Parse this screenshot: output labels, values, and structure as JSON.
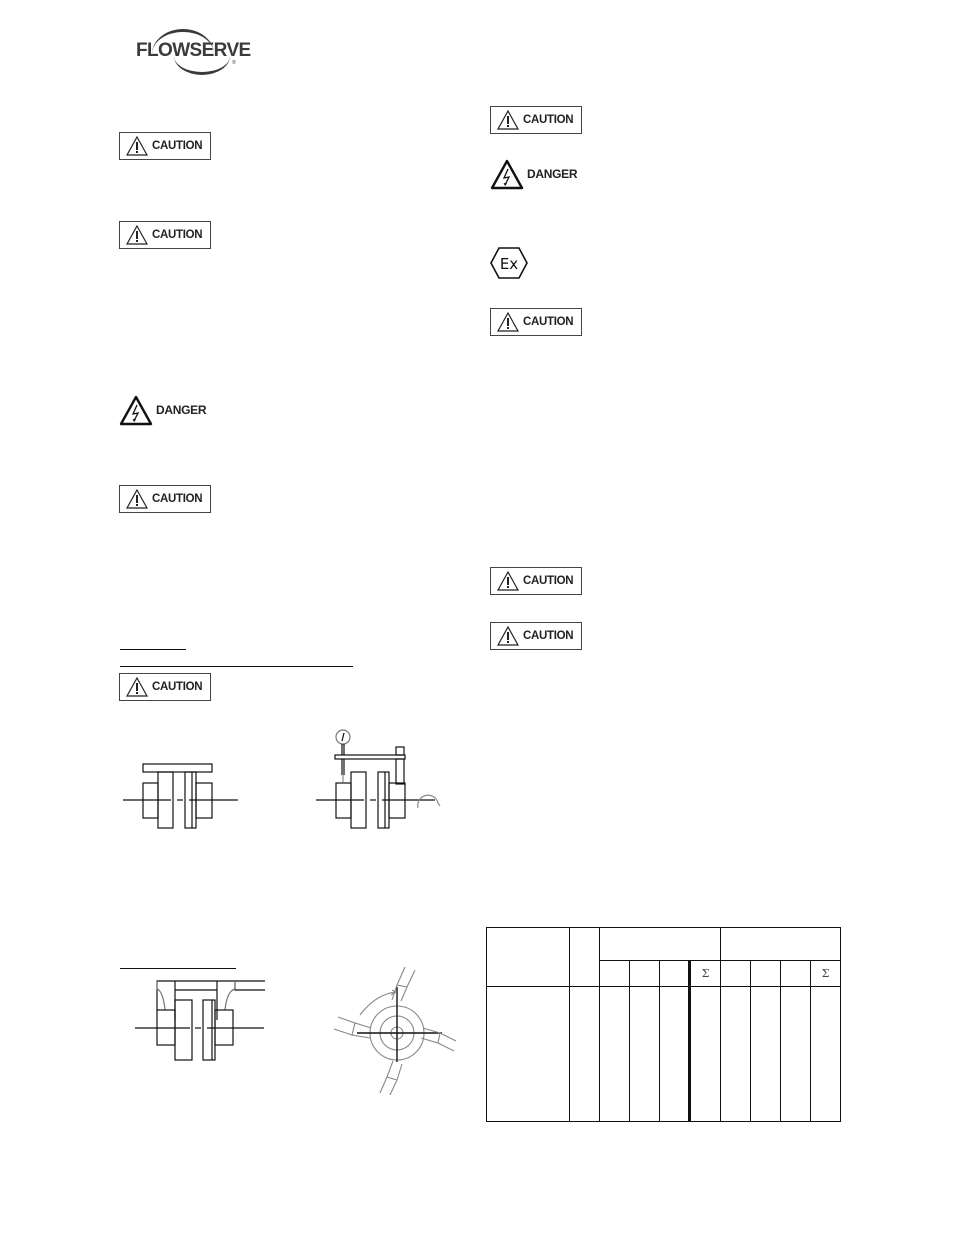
{
  "header": {
    "logo_text": "FLOWSERVE",
    "logo_reg": "®"
  },
  "left_column": {
    "notices": [
      {
        "type": "caution",
        "label": "CAUTION",
        "icon": "warning-triangle-icon"
      },
      {
        "type": "caution",
        "label": "CAUTION",
        "icon": "warning-triangle-icon"
      },
      {
        "type": "danger",
        "label": "DANGER",
        "icon": "electrical-hazard-icon"
      },
      {
        "type": "caution",
        "label": "CAUTION",
        "icon": "warning-triangle-icon"
      },
      {
        "type": "caution",
        "label": "CAUTION",
        "icon": "warning-triangle-icon"
      }
    ],
    "figures": [
      {
        "name": "coupling-alignment-straightedge-figure"
      },
      {
        "name": "coupling-alignment-dial-indicator-figure"
      },
      {
        "name": "coupling-alignment-bracket-figure"
      },
      {
        "name": "coupling-rotation-measurement-figure"
      }
    ]
  },
  "right_column": {
    "notices": [
      {
        "type": "caution",
        "label": "CAUTION",
        "icon": "warning-triangle-icon"
      },
      {
        "type": "danger",
        "label": "DANGER",
        "icon": "electrical-hazard-icon"
      },
      {
        "type": "ex",
        "label": "Ex",
        "icon": "explosion-proof-hexagon-icon"
      },
      {
        "type": "caution",
        "label": "CAUTION",
        "icon": "warning-triangle-icon"
      },
      {
        "type": "caution",
        "label": "CAUTION",
        "icon": "warning-triangle-icon"
      },
      {
        "type": "caution",
        "label": "CAUTION",
        "icon": "warning-triangle-icon"
      }
    ]
  },
  "table": {
    "sum_symbol": "Σ",
    "header_row2": [
      "",
      "",
      "",
      "Σ",
      "",
      "",
      "",
      "Σ"
    ]
  }
}
